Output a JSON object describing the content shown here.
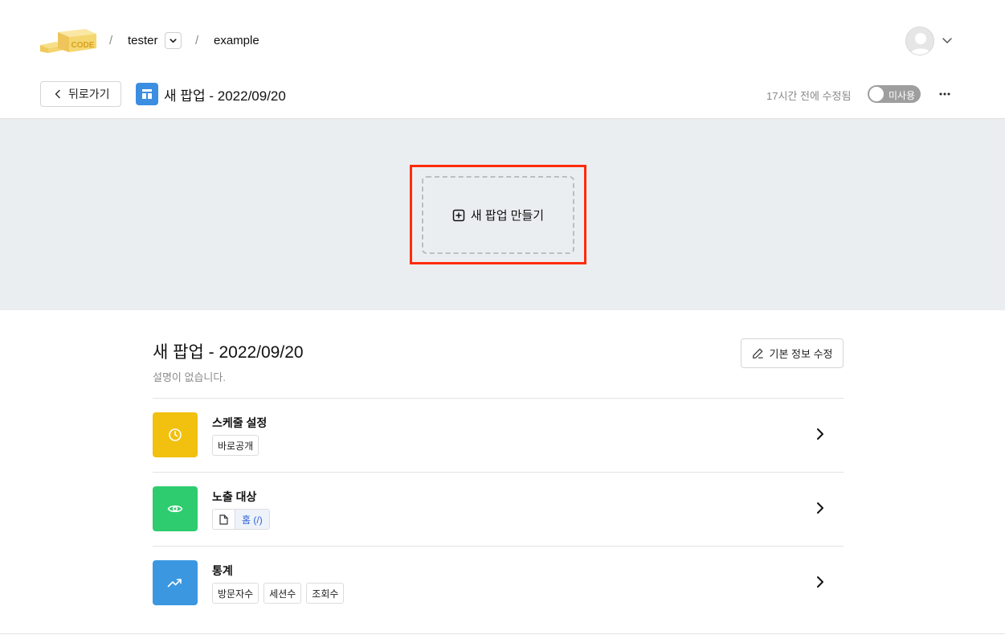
{
  "nav": {
    "logo_text": "CODE",
    "breadcrumb": [
      {
        "label": "tester"
      },
      {
        "label": "example"
      }
    ],
    "separator": "/"
  },
  "subheader": {
    "back_label": "뒤로가기",
    "title": "새 팝업 - 2022/09/20",
    "modified": "17시간 전에 수정됨",
    "toggle_label": "미사용"
  },
  "canvas": {
    "create_label": "새 팝업 만들기"
  },
  "info": {
    "title": "새 팝업 - 2022/09/20",
    "description": "설명이 없습니다.",
    "edit_label": "기본 정보 수정"
  },
  "settings": [
    {
      "title": "스케줄 설정",
      "tags": [
        "바로공개"
      ],
      "color": "#f2c00e",
      "icon": "clock-icon"
    },
    {
      "title": "노출 대상",
      "page": "홈 (/)",
      "color": "#2ecc6e",
      "icon": "eye-icon"
    },
    {
      "title": "통계",
      "tags": [
        "방문자수",
        "세션수",
        "조회수"
      ],
      "color": "#3b97e0",
      "icon": "trending-up-icon"
    }
  ],
  "colors": {
    "highlight": "#ff2b0a",
    "popup_icon": "#3b8ee0",
    "canvas_bg": "#ebeef0"
  }
}
